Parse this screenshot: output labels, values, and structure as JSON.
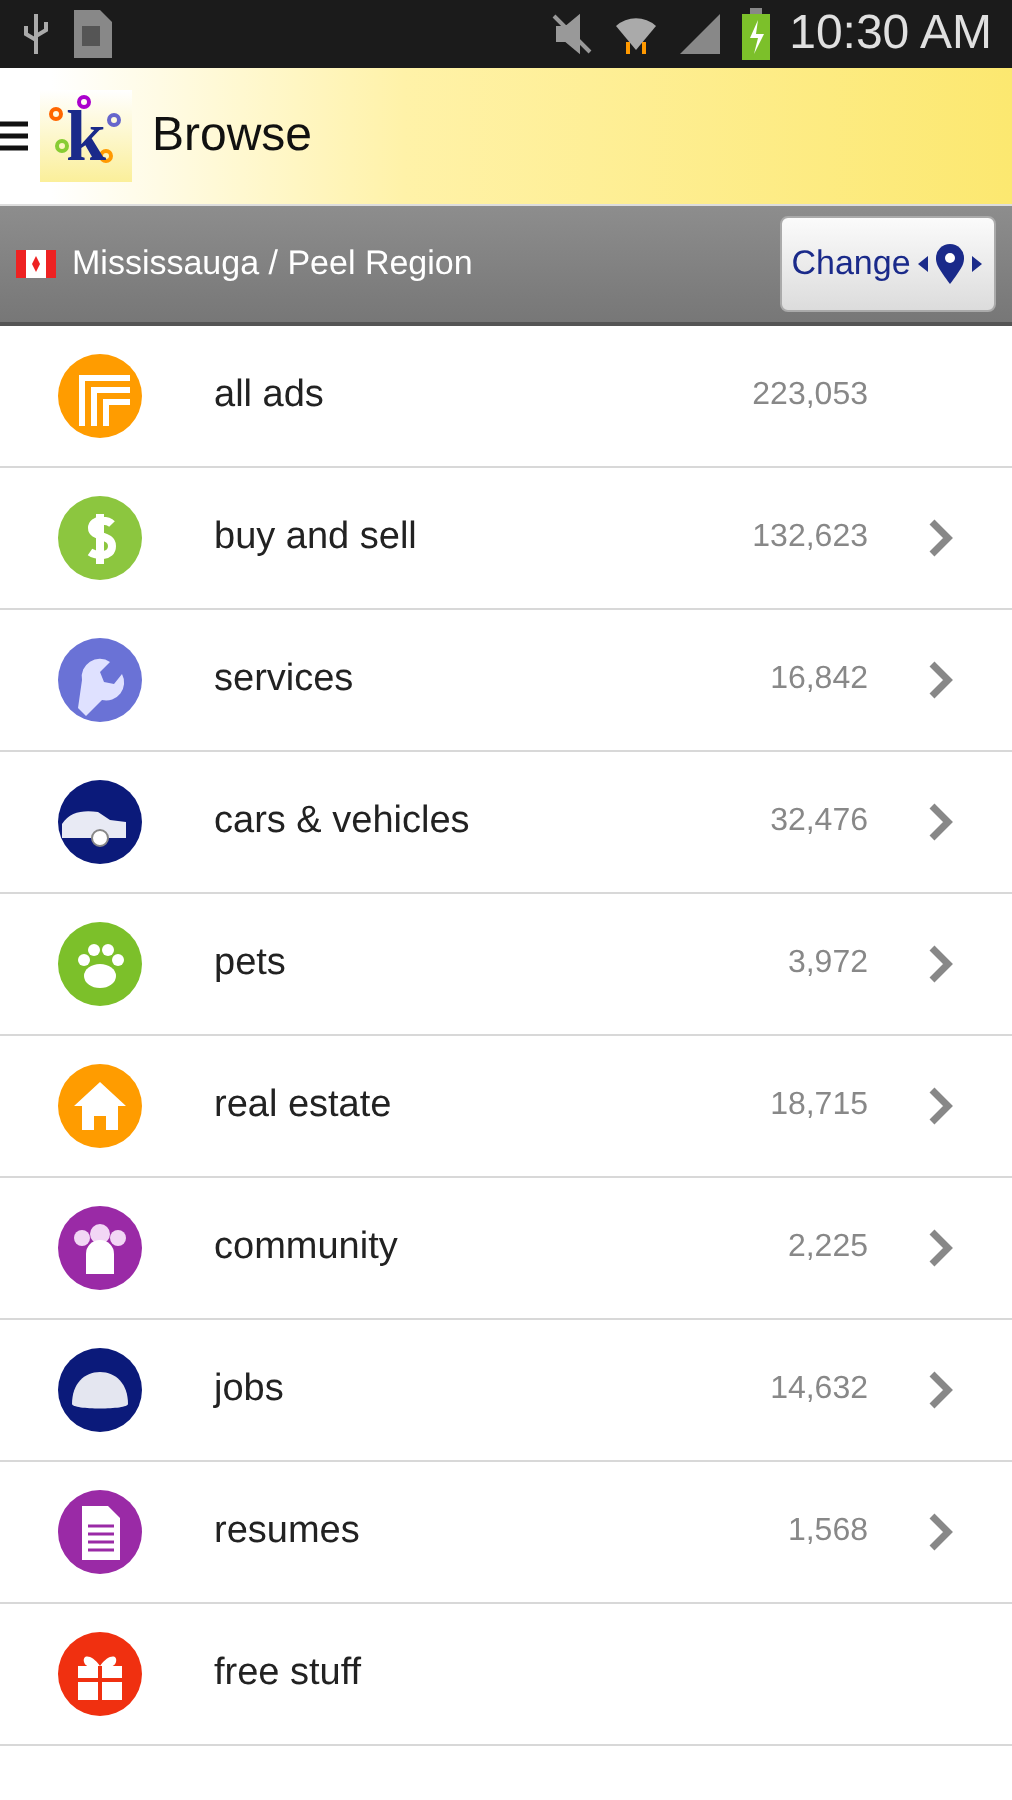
{
  "status_bar": {
    "time": "10:30 AM"
  },
  "app_bar": {
    "logo_letter": "k",
    "title": "Browse"
  },
  "location": {
    "name": "Mississauga / Peel Region",
    "button": "Change"
  },
  "categories": [
    {
      "label": "all ads",
      "count": "223,053",
      "kind": "stack",
      "color": "#ff9c00",
      "arrow": false
    },
    {
      "label": "buy and sell",
      "count": "132,623",
      "kind": "dollar",
      "color": "#8cc63f",
      "arrow": true
    },
    {
      "label": "services",
      "count": "16,842",
      "kind": "wrench",
      "color": "#6a72d6",
      "arrow": true
    },
    {
      "label": "cars & vehicles",
      "count": "32,476",
      "kind": "car",
      "color": "#0b1a7a",
      "arrow": true
    },
    {
      "label": "pets",
      "count": "3,972",
      "kind": "paw",
      "color": "#7cc02a",
      "arrow": true
    },
    {
      "label": "real estate",
      "count": "18,715",
      "kind": "house",
      "color": "#ff9c00",
      "arrow": true
    },
    {
      "label": "community",
      "count": "2,225",
      "kind": "people",
      "color": "#9a2aa6",
      "arrow": true
    },
    {
      "label": "jobs",
      "count": "14,632",
      "kind": "helmet",
      "color": "#0b1a7a",
      "arrow": true
    },
    {
      "label": "resumes",
      "count": "1,568",
      "kind": "document",
      "color": "#9a2aa6",
      "arrow": true
    },
    {
      "label": "free stuff",
      "kind": "gift",
      "color": "#f03010",
      "arrow": false
    }
  ]
}
